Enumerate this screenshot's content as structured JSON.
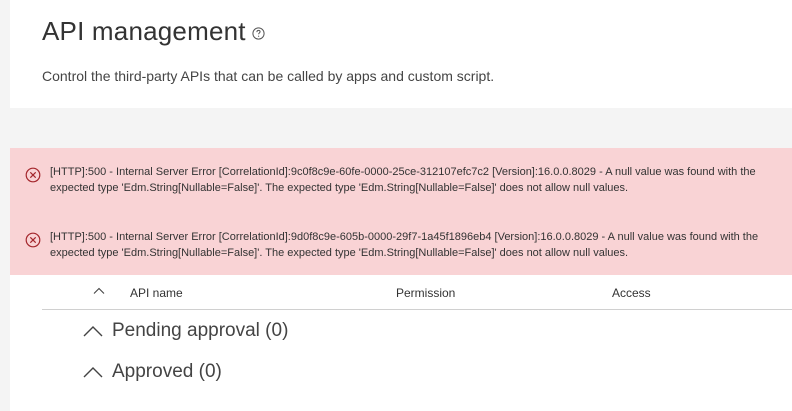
{
  "header": {
    "title": "API management",
    "help_icon": "help-circle-icon",
    "subtitle": "Control the third-party APIs that can be called by apps and custom script."
  },
  "errors": [
    {
      "icon": "error-circle-x-icon",
      "message": "[HTTP]:500 - Internal Server Error [CorrelationId]:9c0f8c9e-60fe-0000-25ce-312107efc7c2 [Version]:16.0.0.8029 - A null value was found with the expected type 'Edm.String[Nullable=False]'. The expected type 'Edm.String[Nullable=False]' does not allow null values."
    },
    {
      "icon": "error-circle-x-icon",
      "message": "[HTTP]:500 - Internal Server Error [CorrelationId]:9d0f8c9e-605b-0000-29f7-1a45f1896eb4 [Version]:16.0.0.8029 - A null value was found with the expected type 'Edm.String[Nullable=False]'. The expected type 'Edm.String[Nullable=False]' does not allow null values."
    }
  ],
  "table": {
    "columns": [
      "API name",
      "Permission",
      "Access"
    ],
    "groups": [
      {
        "label": "Pending approval (0)",
        "icon": "chevron-up-icon"
      },
      {
        "label": "Approved (0)",
        "icon": "chevron-up-icon"
      }
    ]
  },
  "colors": {
    "error_background": "#f9d3d5",
    "error_icon": "#a4262c",
    "band": "#f4f4f4"
  }
}
